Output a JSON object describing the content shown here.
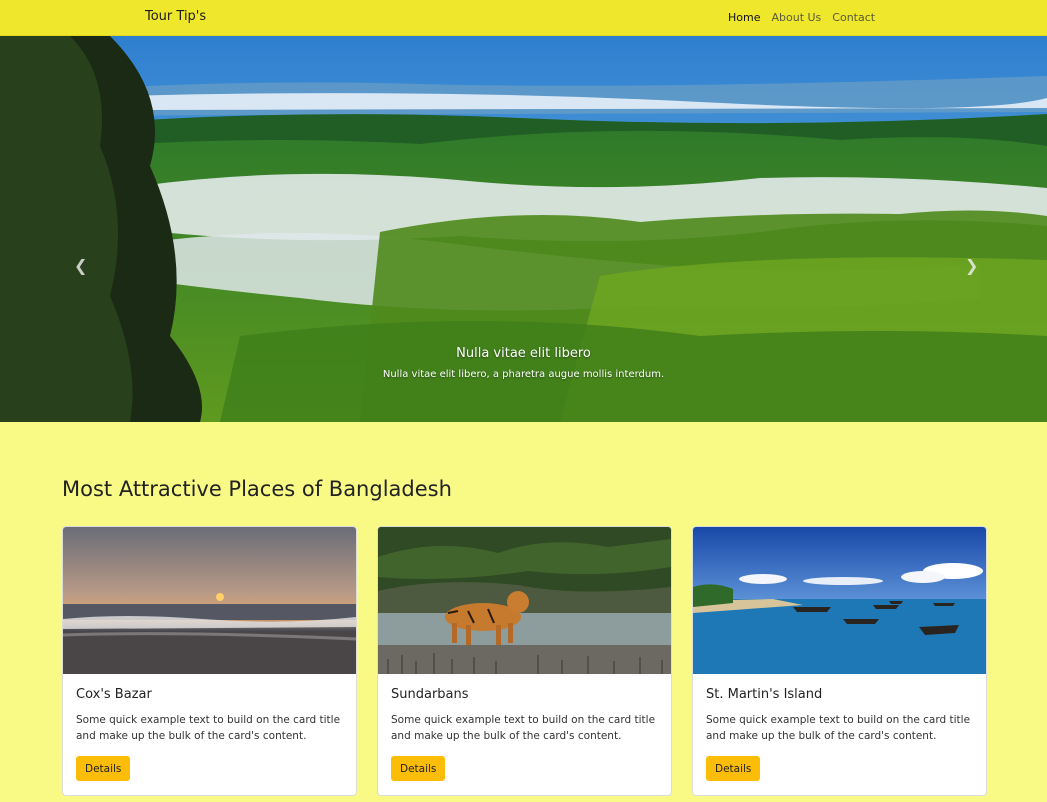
{
  "navbar": {
    "brand": "Tour Tip's",
    "links": [
      {
        "label": "Home",
        "active": true
      },
      {
        "label": "About Us",
        "active": false
      },
      {
        "label": "Contact",
        "active": false
      }
    ]
  },
  "hero": {
    "caption_title": "Nulla vitae elit libero",
    "caption_text": "Nulla vitae elit libero, a pharetra augue mollis interdum.",
    "prev_icon": "chevron-left-icon",
    "next_icon": "chevron-right-icon"
  },
  "section": {
    "title": "Most Attractive Places of Bangladesh"
  },
  "cards": [
    {
      "title": "Cox's Bazar",
      "text": "Some quick example text to build on the card title and make up the bulk of the card's content.",
      "button": "Details"
    },
    {
      "title": "Sundarbans",
      "text": "Some quick example text to build on the card title and make up the bulk of the card's content.",
      "button": "Details"
    },
    {
      "title": "St. Martin's Island",
      "text": "Some quick example text to build on the card title and make up the bulk of the card's content.",
      "button": "Details"
    }
  ],
  "colors": {
    "navbar": "#efe72c",
    "page_background": "#f8fa85",
    "button": "#fbbd08"
  }
}
